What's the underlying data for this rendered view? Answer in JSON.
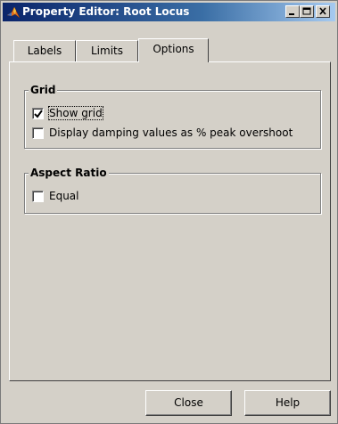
{
  "window": {
    "title": "Property Editor: Root Locus"
  },
  "title_buttons": {
    "minimize": "minimize-icon",
    "maximize": "maximize-icon",
    "close": "close-icon"
  },
  "tabs": [
    {
      "label": "Labels",
      "active": false
    },
    {
      "label": "Limits",
      "active": false
    },
    {
      "label": "Options",
      "active": true
    }
  ],
  "grid_group": {
    "title": "Grid",
    "show_grid": {
      "label": "Show grid",
      "checked": true
    },
    "damping": {
      "label": "Display damping values as % peak overshoot",
      "checked": false
    }
  },
  "aspect_group": {
    "title": "Aspect Ratio",
    "equal": {
      "label": "Equal",
      "checked": false
    }
  },
  "buttons": {
    "close": "Close",
    "help": "Help"
  }
}
